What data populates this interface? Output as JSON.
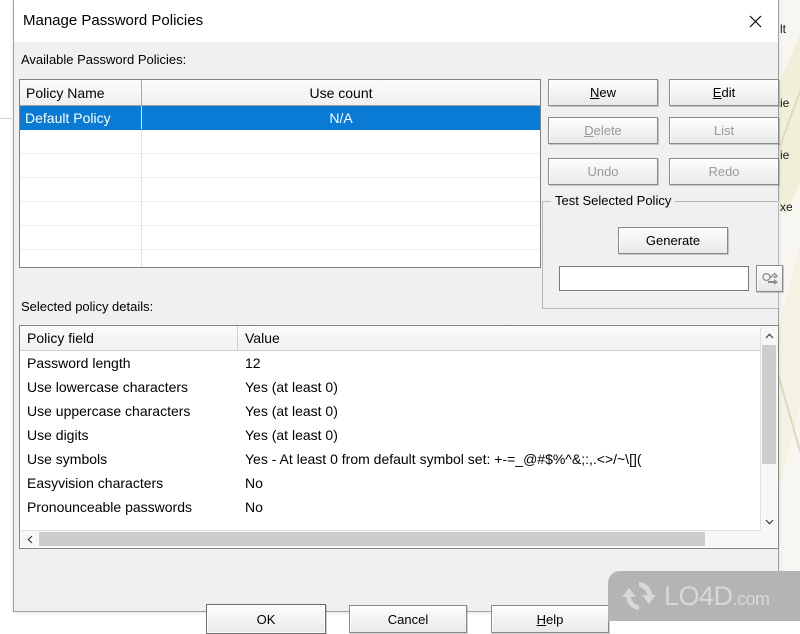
{
  "background": {
    "texts": [
      "lt",
      "ie",
      "ie",
      "xe"
    ]
  },
  "window": {
    "title": "Manage Password Policies",
    "close_icon": "close-icon"
  },
  "labels": {
    "available_policies": "Available Password Policies:",
    "selected_policy_details": "Selected policy details:"
  },
  "policies_table": {
    "columns": [
      "Policy Name",
      "Use count"
    ],
    "rows": [
      {
        "name": "Default Policy",
        "use_count": "N/A",
        "selected": true
      }
    ],
    "empty_row_count": 6,
    "selection_color": "#0a7bd4"
  },
  "actions": {
    "new": {
      "label": "New",
      "accel": "N",
      "enabled": true
    },
    "edit": {
      "label": "Edit",
      "accel": "E",
      "enabled": true
    },
    "delete": {
      "label": "Delete",
      "accel": "D",
      "enabled": false
    },
    "list": {
      "label": "List",
      "accel": "",
      "enabled": false
    },
    "undo": {
      "label": "Undo",
      "accel": "",
      "enabled": false
    },
    "redo": {
      "label": "Redo",
      "accel": "",
      "enabled": false
    }
  },
  "test_group": {
    "title": "Test Selected Policy",
    "generate_label": "Generate",
    "password_value": "",
    "password_placeholder": "",
    "copy_icon": "key-copy-icon"
  },
  "details_table": {
    "columns": [
      "Policy field",
      "Value"
    ],
    "rows": [
      {
        "field": "Password length",
        "value": "12"
      },
      {
        "field": "Use lowercase characters",
        "value": "Yes (at least 0)"
      },
      {
        "field": "Use uppercase characters",
        "value": "Yes (at least 0)"
      },
      {
        "field": "Use digits",
        "value": "Yes (at least 0)"
      },
      {
        "field": "Use symbols",
        "value": "Yes - At least 0 from default symbol set: +-=_@#$%^&;:,.<>/~\\[]("
      },
      {
        "field": "Easyvision characters",
        "value": "No"
      },
      {
        "field": "Pronounceable passwords",
        "value": "No"
      }
    ],
    "scroll_up_icon": "chevron-up-icon",
    "scroll_down_icon": "chevron-down-icon",
    "scroll_left_icon": "chevron-left-icon",
    "scroll_right_icon": "chevron-right-icon"
  },
  "footer": {
    "ok": {
      "label": "OK",
      "accel": ""
    },
    "cancel": {
      "label": "Cancel",
      "accel": ""
    },
    "help": {
      "label": "Help",
      "accel": "H"
    }
  },
  "watermark": {
    "brand": "LO4D",
    "suffix": ".com",
    "logo_icon": "circular-arrows-icon"
  }
}
